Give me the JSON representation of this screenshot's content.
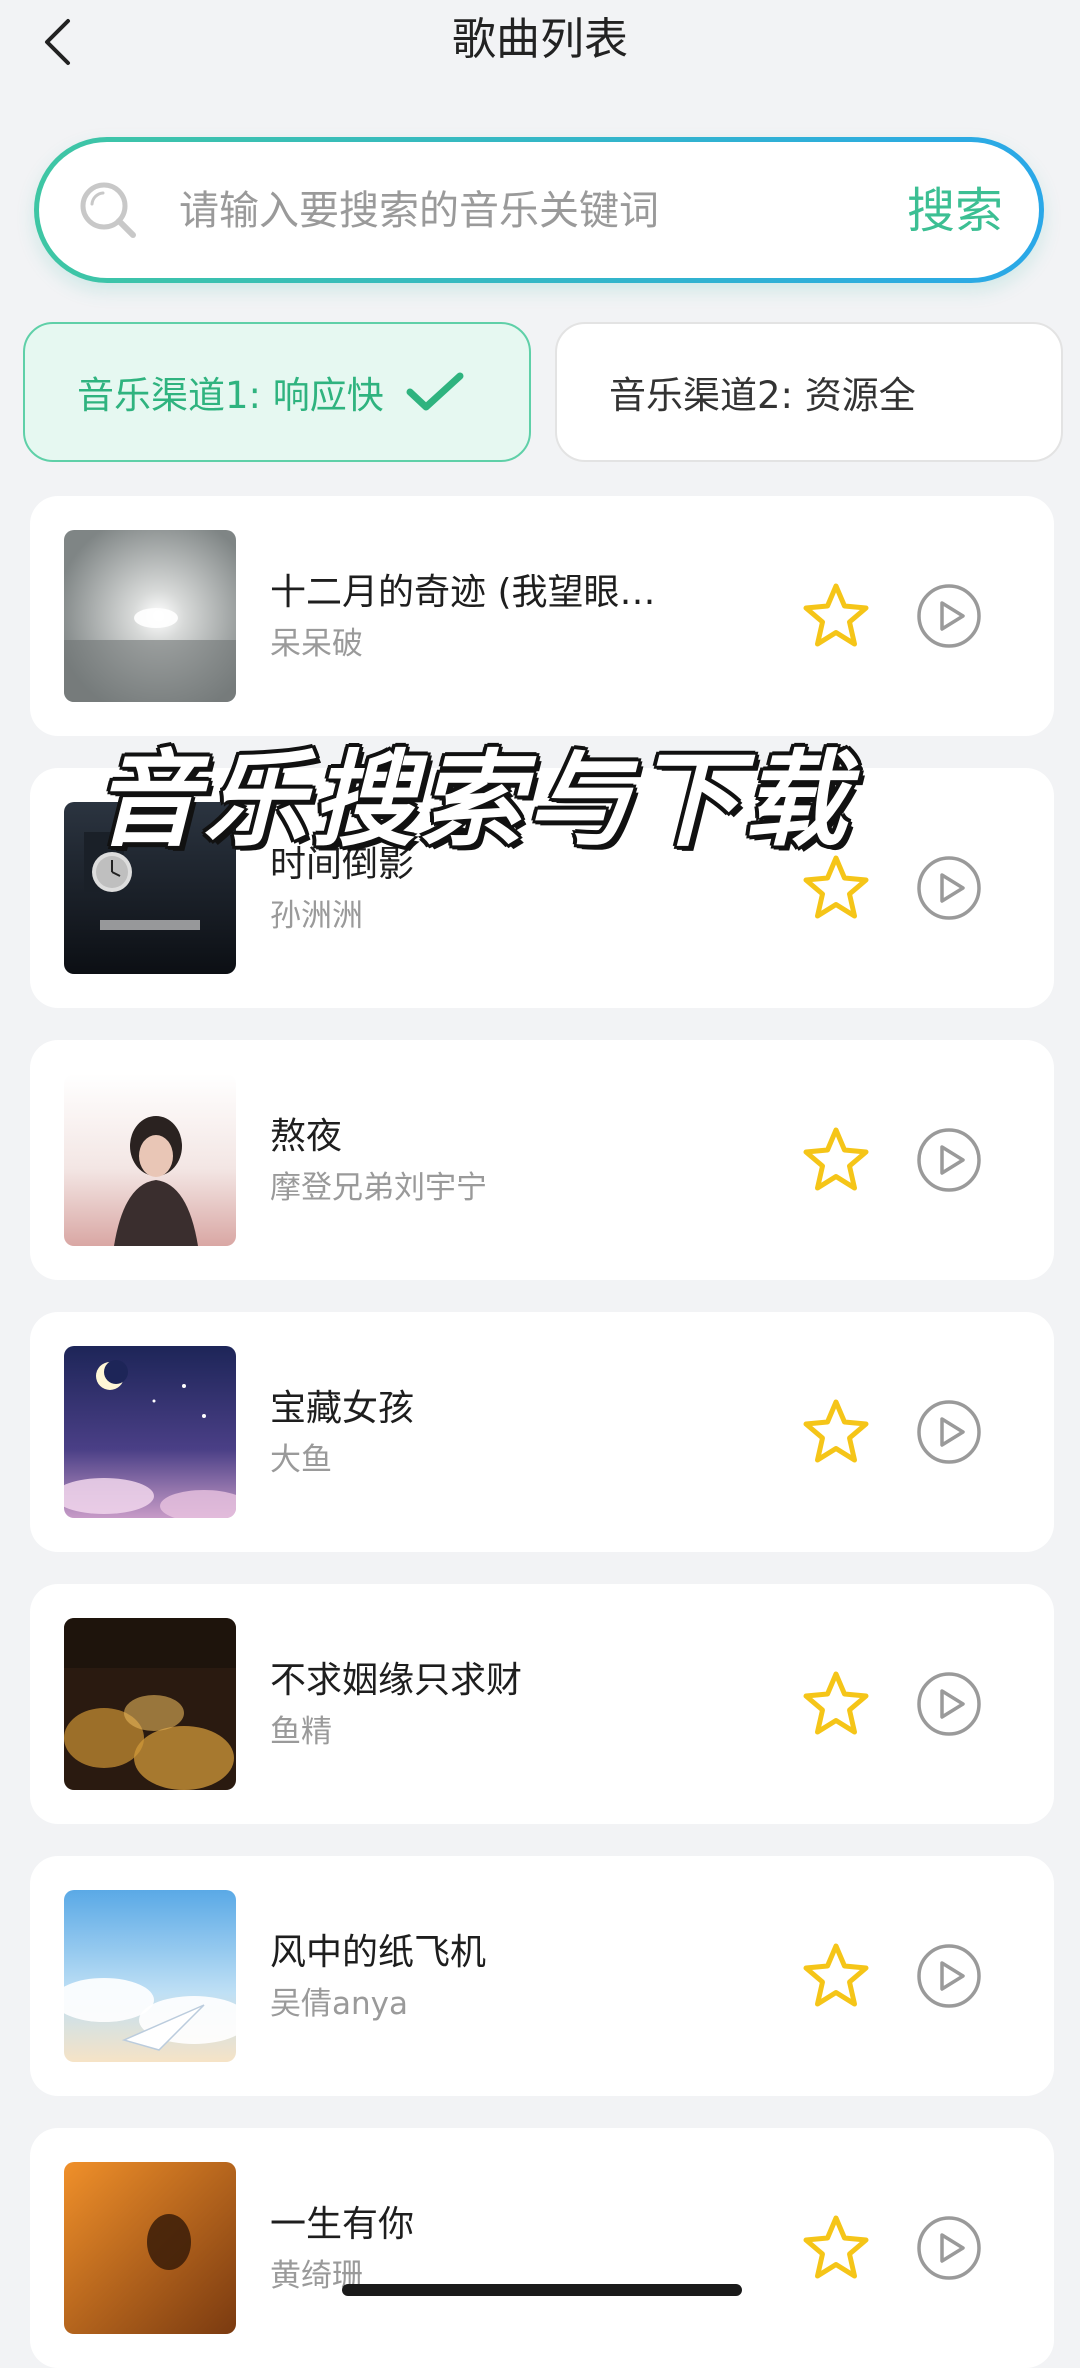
{
  "header": {
    "title": "歌曲列表",
    "back_icon": "chevron-left-icon"
  },
  "search": {
    "placeholder": "请输入要搜索的音乐关键词",
    "button_label": "搜索",
    "icon": "search-icon"
  },
  "channels": [
    {
      "label": "音乐渠道1: 响应快",
      "selected": true,
      "icon": "check-icon"
    },
    {
      "label": "音乐渠道2: 资源全",
      "selected": false
    }
  ],
  "songs": [
    {
      "title": "十二月的奇迹 (我望眼…",
      "artist": "呆呆破"
    },
    {
      "title": "时间倒影",
      "artist": "孙洲洲"
    },
    {
      "title": "熬夜",
      "artist": "摩登兄弟刘宇宁"
    },
    {
      "title": "宝藏女孩",
      "artist": "大鱼"
    },
    {
      "title": "不求姻缘只求财",
      "artist": "鱼精"
    },
    {
      "title": "风中的纸飞机",
      "artist": "吴倩anya"
    },
    {
      "title": "一生有你",
      "artist": "黄绮珊"
    }
  ],
  "overlay_caption": "音乐搜索与下载",
  "colors": {
    "accent": "#3cbf93",
    "star": "#f5c518",
    "play": "#9a9a9a"
  }
}
